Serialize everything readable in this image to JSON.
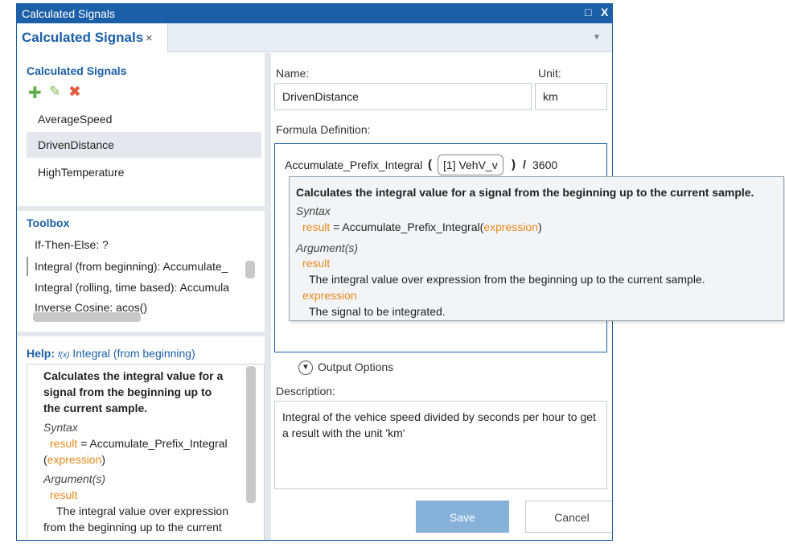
{
  "window": {
    "title": "Calculated Signals",
    "restore_icon": "□",
    "close_icon": "X"
  },
  "tab": {
    "label": "Calculated Signals",
    "close": "×",
    "menu": "▼"
  },
  "signals": {
    "title": "Calculated Signals",
    "icons": {
      "add": "add-icon",
      "edit": "edit-icon",
      "delete": "delete-icon"
    },
    "colors": {
      "add": "#5fb04a",
      "edit": "#7cbc4c",
      "delete": "#e2583b"
    },
    "items": [
      {
        "label": "AverageSpeed"
      },
      {
        "label": "DrivenDistance",
        "selected": true
      },
      {
        "label": "HighTemperature"
      }
    ]
  },
  "toolbox": {
    "title": "Toolbox",
    "items": [
      {
        "label": "If-Then-Else: ?"
      },
      {
        "label": "Integral (from beginning): Accumulate_",
        "selected": true
      },
      {
        "label": "Integral (rolling, time based): Accumula"
      },
      {
        "label": "Inverse Cosine: acos()"
      }
    ]
  },
  "help": {
    "title_prefix": "Help:",
    "fx_icon": "f(x)",
    "title": "Integral (from beginning)",
    "summary_1": "Calculates the integral value for a",
    "summary_2": "signal from the beginning up to",
    "summary_3": "the current sample.",
    "syntax_label": "Syntax",
    "syntax_result": "result",
    "syntax_eq": " = Accumulate_Prefix_Integral",
    "syntax_paren_open": "(",
    "syntax_expression": "expression",
    "syntax_paren_close": ")",
    "args_label": "Argument(s)",
    "arg_result": "result",
    "arg_result_desc_1": "The integral value over expression",
    "arg_result_desc_2": "from the beginning up to the current"
  },
  "form": {
    "name_label": "Name:",
    "name_value": "DrivenDistance",
    "unit_label": "Unit:",
    "unit_value": "km",
    "formula_label": "Formula Definition:",
    "formula": {
      "func": "Accumulate_Prefix_Integral",
      "paren_open": "(",
      "chip": "[1] VehV_v",
      "paren_close": ")",
      "operator": "/",
      "constant": "3600"
    },
    "output_options": "Output Options",
    "description_label": "Description:",
    "description": "Integral of the vehice speed divided by seconds per hour to get a result with the unit 'km'",
    "save": "Save",
    "cancel": "Cancel"
  },
  "tooltip": {
    "summary": "Calculates the integral value for a signal from the beginning up to the current sample.",
    "syntax_label": "Syntax",
    "syntax_result": "result",
    "syntax_rest_1": " = Accumulate_Prefix_Integral(",
    "syntax_expression": "expression",
    "syntax_rest_2": ")",
    "args_label": "Argument(s)",
    "arg_result": "result",
    "arg_result_desc": "The integral value over expression from the beginning up to the current sample.",
    "arg_expression": "expression",
    "arg_expression_desc": "The signal to be integrated."
  }
}
